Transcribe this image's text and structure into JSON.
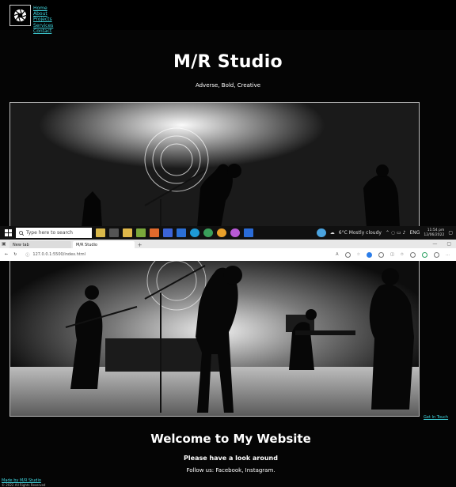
{
  "nav": {
    "items": [
      "Home",
      "About",
      "Projects",
      "Services",
      "Contact"
    ]
  },
  "hero": {
    "title": "M/R Studio",
    "tagline": "Adverse, Bold, Creative"
  },
  "taskbar": {
    "search_placeholder": "Type here to search",
    "weather": "6°C  Mostly cloudy",
    "language": "ENG",
    "time": "11:54 pm",
    "date": "12/06/2022"
  },
  "browser": {
    "tabs": [
      "New tab",
      "M/R Studio"
    ],
    "url": "127.0.0.1:5500/index.html"
  },
  "main": {
    "contact_link": "Get In Touch",
    "heading": "Welcome to My Website",
    "subheading": "Please have a look around",
    "follow": "Follow us: Facebook, Instagram."
  },
  "footer": {
    "credit": "Made by M/R Studio",
    "copyright": "© 2022 All Rights Reserved"
  },
  "colors": {
    "background": "#050505",
    "link": "#40d6df",
    "text": "#ffffff"
  }
}
